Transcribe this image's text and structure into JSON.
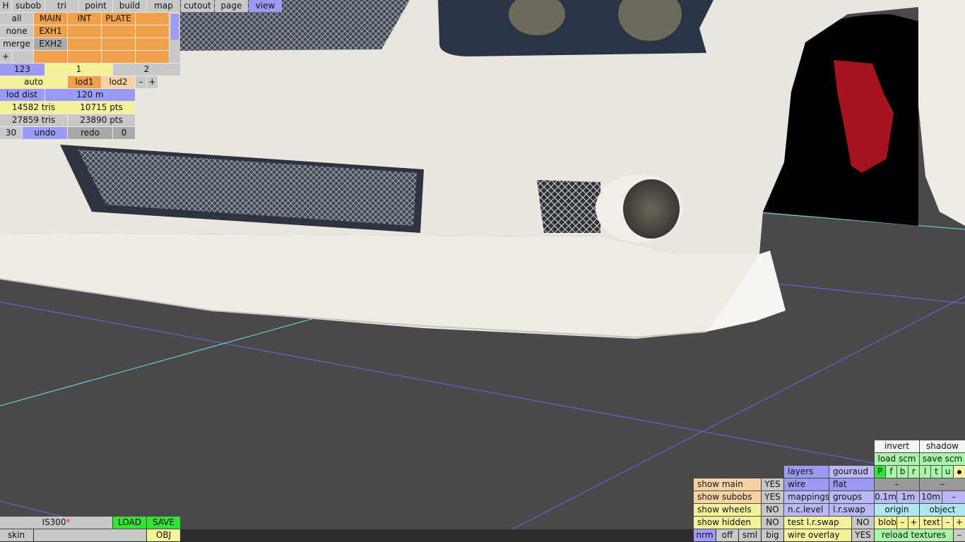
{
  "top_menu": {
    "items": [
      "H",
      "subob",
      "tri",
      "point",
      "build",
      "map",
      "cutout",
      "page",
      "view"
    ],
    "active": "view"
  },
  "layers": {
    "left_buttons": [
      "all",
      "none",
      "merge",
      "+"
    ],
    "names": [
      "MAIN",
      "INT",
      "PLATE",
      "EXH1",
      "EXH2"
    ]
  },
  "view_numbers": {
    "a": "123",
    "b": "1",
    "c": "2"
  },
  "lod": {
    "auto": "auto",
    "lod1": "lod1",
    "lod2": "lod2",
    "minus": "–",
    "plus": "+",
    "dist_label": "lod dist",
    "dist_value": "120 m"
  },
  "stats": {
    "tris1": "14582 tris",
    "pts1": "10715 pts",
    "tris2": "27859 tris",
    "pts2": "23890 pts"
  },
  "undo": {
    "count": "30",
    "undo": "undo",
    "redo": "redo",
    "redo_count": "0"
  },
  "file": {
    "name": "IS300",
    "modified_mark": "*",
    "load": "LOAD",
    "save": "SAVE",
    "skin": "skin",
    "obj": "OBJ"
  },
  "display": {
    "rows": [
      {
        "label": "show main",
        "value": "YES"
      },
      {
        "label": "show subobs",
        "value": "YES"
      },
      {
        "label": "show wheels",
        "value": "NO"
      },
      {
        "label": "show hidden",
        "value": "NO"
      }
    ],
    "nrm": "nrm",
    "off": "off",
    "sml": "sml",
    "big": "big",
    "layers": "layers",
    "gouraud": "gouraud",
    "wire": "wire",
    "flat": "flat",
    "mappings": "mappings",
    "groups": "groups",
    "nclevel": "n.c.level",
    "lrswap": "l.r.swap",
    "test_lrswap": "test l.r.swap",
    "test_lrswap_value": "NO",
    "wire_overlay": "wire overlay",
    "wire_overlay_value": "YES",
    "invert": "invert",
    "shadow": "shadow",
    "load_scm": "load scm",
    "save_scm": "save scm",
    "pfbrltu": [
      "P",
      "f",
      "b",
      "r",
      "l",
      "t",
      "u"
    ],
    "dash1": "–",
    "dash2": "–",
    "dist1": "0.1m",
    "dist2": "1m",
    "dist3": "10m",
    "dist_minus": "–",
    "origin": "origin",
    "object": "object",
    "blob": "blob",
    "text": "text",
    "minus": "–",
    "plus": "+",
    "reload_textures": "reload textures"
  }
}
